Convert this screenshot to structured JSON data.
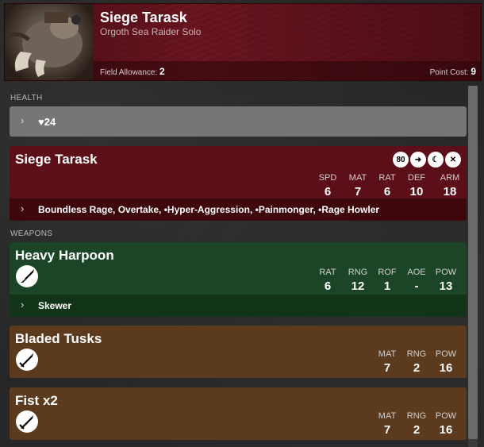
{
  "header": {
    "title": "Siege Tarask",
    "subtitle": "Orgoth Sea Raider Solo",
    "field_allowance_label": "Field Allowance:",
    "field_allowance_value": "2",
    "point_cost_label": "Point Cost:",
    "point_cost_value": "9"
  },
  "health": {
    "section_label": "HEALTH",
    "value": "24",
    "icon": "heart-icon"
  },
  "model": {
    "name": "Siege Tarask",
    "badges": [
      {
        "text": "80",
        "icon": "base-size-badge"
      },
      {
        "text": "",
        "icon": "advance-arrows-icon"
      },
      {
        "text": "",
        "icon": "moon-icon"
      },
      {
        "text": "",
        "icon": "crossed-swords-icon"
      }
    ],
    "stats": [
      {
        "label": "SPD",
        "value": "6"
      },
      {
        "label": "MAT",
        "value": "7"
      },
      {
        "label": "RAT",
        "value": "6"
      },
      {
        "label": "DEF",
        "value": "10"
      },
      {
        "label": "ARM",
        "value": "18"
      }
    ],
    "abilities": "Boundless Rage, Overtake, •Hyper-Aggression, •Painmonger, •Rage Howler"
  },
  "weapons_label": "WEAPONS",
  "weapons": [
    {
      "name": "Heavy Harpoon",
      "icon": "ranged-weapon-icon",
      "stats": [
        {
          "label": "RAT",
          "value": "6"
        },
        {
          "label": "RNG",
          "value": "12"
        },
        {
          "label": "ROF",
          "value": "1"
        },
        {
          "label": "AOE",
          "value": "-"
        },
        {
          "label": "POW",
          "value": "13"
        }
      ],
      "special": "Skewer"
    },
    {
      "name": "Bladed Tusks",
      "icon": "melee-weapon-icon",
      "stats": [
        {
          "label": "MAT",
          "value": "7"
        },
        {
          "label": "RNG",
          "value": "2"
        },
        {
          "label": "POW",
          "value": "16"
        }
      ]
    },
    {
      "name": "Fist x2",
      "icon": "melee-weapon-icon",
      "stats": [
        {
          "label": "MAT",
          "value": "7"
        },
        {
          "label": "RNG",
          "value": "2"
        },
        {
          "label": "POW",
          "value": "16"
        }
      ]
    }
  ]
}
